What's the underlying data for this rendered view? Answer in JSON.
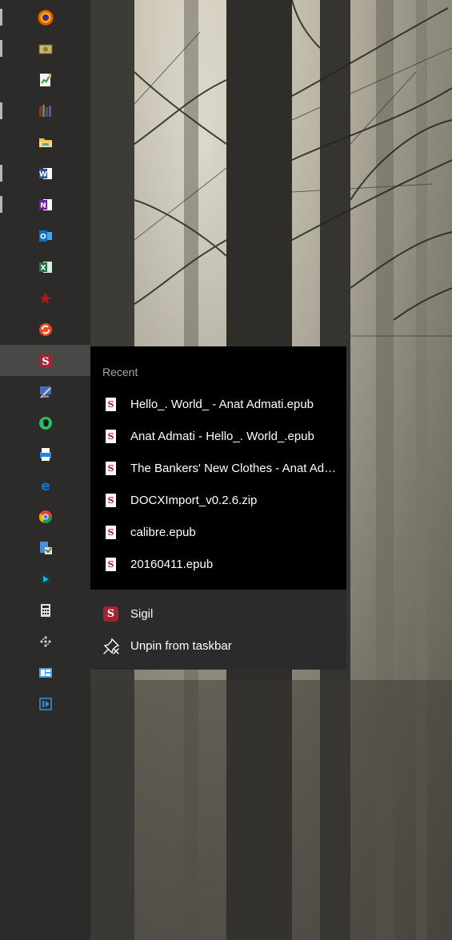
{
  "taskbar": {
    "icons": [
      {
        "name": "firefox-icon",
        "color": "#e66000",
        "running": true
      },
      {
        "name": "money-app-icon",
        "color": "#b9a45a",
        "running": true
      },
      {
        "name": "spreadsheet-editor-icon",
        "color": "#5aa64a",
        "running": false
      },
      {
        "name": "library-books-icon",
        "color": "#a0522d",
        "running": true
      },
      {
        "name": "file-explorer-icon",
        "color": "#f2c14e",
        "running": false
      },
      {
        "name": "word-icon",
        "color": "#2b579a",
        "running": true
      },
      {
        "name": "onenote-icon",
        "color": "#7719aa",
        "running": true
      },
      {
        "name": "outlook-icon",
        "color": "#0072c6",
        "running": false
      },
      {
        "name": "excel-icon",
        "color": "#217346",
        "running": false
      },
      {
        "name": "acrobat-icon",
        "color": "#c0161b",
        "running": false
      },
      {
        "name": "sync-app-icon",
        "color": "#e64a19",
        "running": false
      },
      {
        "name": "sigil-icon",
        "color": "#a3232e",
        "running": false,
        "active": true
      },
      {
        "name": "remote-tool-icon",
        "color": "#3a6fc1",
        "running": false
      },
      {
        "name": "evernote-icon",
        "color": "#2dbe60",
        "running": false
      },
      {
        "name": "printer-app-icon",
        "color": "#1e88e5",
        "running": false
      },
      {
        "name": "edge-icon",
        "color": "#0078d7",
        "running": false
      },
      {
        "name": "chrome-icon",
        "color": "#db4437",
        "running": false
      },
      {
        "name": "installer-icon",
        "color": "#4a90d9",
        "running": false
      },
      {
        "name": "media-editor-icon",
        "color": "#00bcd4",
        "running": false
      },
      {
        "name": "calculator-icon",
        "color": "#e0e0e0",
        "running": false
      },
      {
        "name": "dots-app-icon",
        "color": "#cccccc",
        "running": false
      },
      {
        "name": "control-panel-icon",
        "color": "#4fa3e0",
        "running": false
      },
      {
        "name": "player-app-icon",
        "color": "#2196f3",
        "running": false
      }
    ]
  },
  "jumplist": {
    "recent_label": "Recent",
    "recent": [
      {
        "label": "Hello_. World_ - Anat Admati.epub"
      },
      {
        "label": "Anat Admati - Hello_. World_.epub"
      },
      {
        "label": "The Bankers' New Clothes - Anat Admati.epub"
      },
      {
        "label": "DOCXImport_v0.2.6.zip"
      },
      {
        "label": "calibre.epub"
      },
      {
        "label": "20160411.epub"
      }
    ],
    "tasks": {
      "app_label": "Sigil",
      "unpin_label": "Unpin from taskbar"
    },
    "file_icon_glyph": "S",
    "accent_color": "#a3232e"
  }
}
